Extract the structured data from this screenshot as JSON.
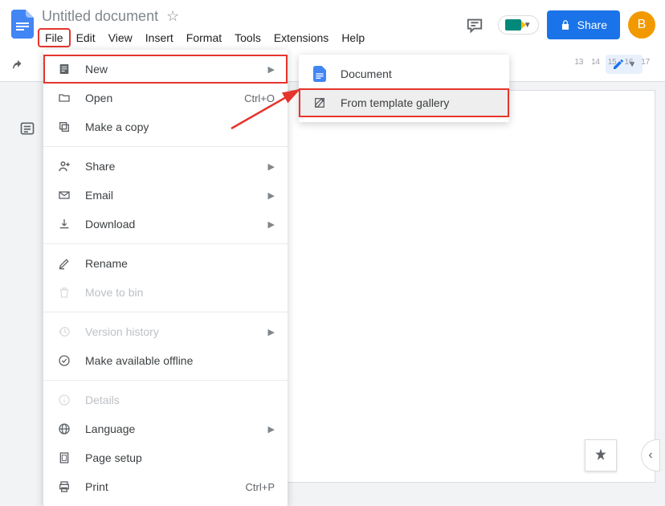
{
  "header": {
    "doc_title": "Untitled document",
    "share_label": "Share",
    "avatar_initial": "B"
  },
  "menubar": {
    "items": [
      "File",
      "Edit",
      "View",
      "Insert",
      "Format",
      "Tools",
      "Extensions",
      "Help"
    ]
  },
  "ruler": [
    "13",
    "14",
    "15",
    "16",
    "17"
  ],
  "file_menu": {
    "new": "New",
    "open": "Open",
    "open_shortcut": "Ctrl+O",
    "make_copy": "Make a copy",
    "share": "Share",
    "email": "Email",
    "download": "Download",
    "rename": "Rename",
    "move_to_bin": "Move to bin",
    "version_history": "Version history",
    "make_available_offline": "Make available offline",
    "details": "Details",
    "language": "Language",
    "page_setup": "Page setup",
    "print": "Print",
    "print_shortcut": "Ctrl+P"
  },
  "new_submenu": {
    "document": "Document",
    "from_template": "From template gallery"
  }
}
